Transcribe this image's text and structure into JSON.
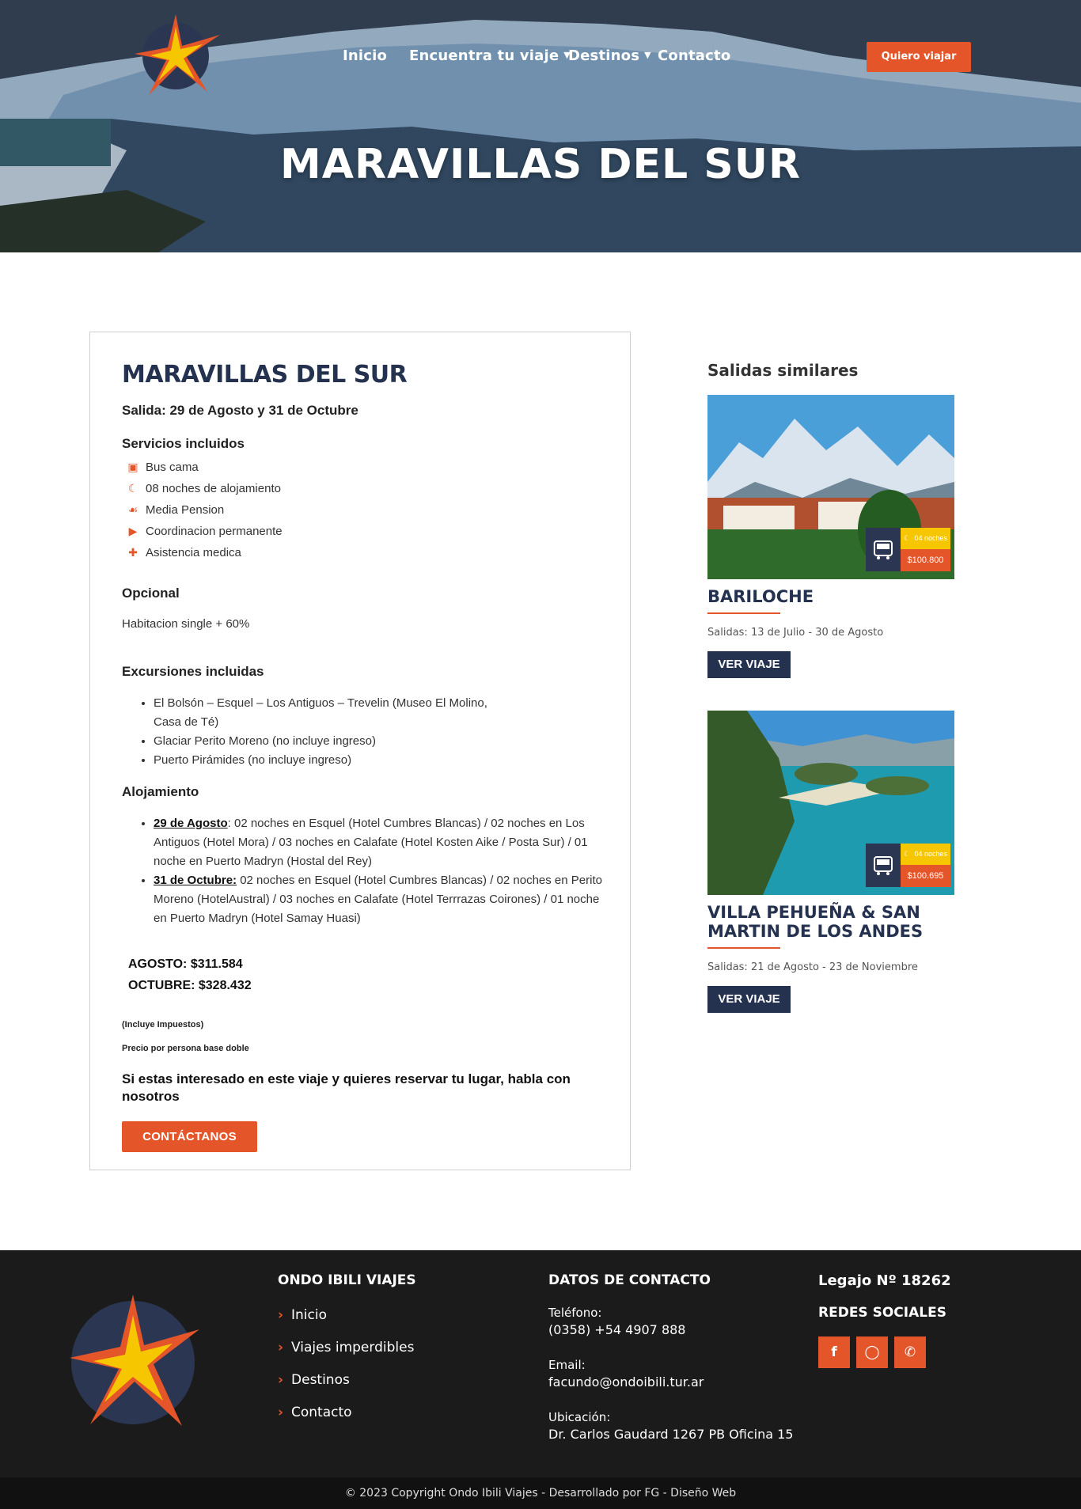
{
  "header": {
    "nav": [
      "Inicio",
      "Encuentra tu viaje",
      "Destinos",
      "Contacto"
    ],
    "cta": "Quiero viajar",
    "hero_title": "MARAVILLAS DEL SUR"
  },
  "trip": {
    "title": "MARAVILLAS DEL SUR",
    "salida": "Salida: 29 de Agosto y 31 de Octubre",
    "services_heading": "Servicios incluidos",
    "services": [
      {
        "icon": "bus-icon",
        "label": "Bus cama"
      },
      {
        "icon": "moon-icon",
        "label": "08 noches de alojamiento"
      },
      {
        "icon": "utensils-icon",
        "label": "Media Pension"
      },
      {
        "icon": "megaphone-icon",
        "label": "Coordinacion permanente"
      },
      {
        "icon": "medical-kit-icon",
        "label": "Asistencia medica"
      }
    ],
    "optional_heading": "Opcional",
    "optional": "Habitacion single  + 60%",
    "excursions_heading": "Excursiones incluidas",
    "excursions": [
      "El Bolsón – Esquel – Los Antiguos – Trevelin (Museo El Molino, Casa de Té)",
      "Glaciar Perito Moreno (no incluye ingreso)",
      "Puerto Pirámides (no incluye ingreso)"
    ],
    "lodging_heading": "Alojamiento",
    "lodging": [
      {
        "date": "29 de Agosto",
        "sep": ":",
        "text": " 02 noches en Esquel (Hotel Cumbres Blancas) / 02 noches en Los Antiguos (Hotel Mora) / 03 noches en Calafate (Hotel Kosten Aike / Posta Sur) / 01 noche en Puerto Madryn (Hostal del Rey)"
      },
      {
        "date": "31 de Octubre:",
        "sep": "",
        "text": " 02 noches en Esquel (Hotel Cumbres Blancas) / 02 noches en Perito Moreno (HotelAustral) / 03 noches en Calafate (Hotel Terrrazas Coirones) / 01 noche en Puerto Madryn (Hotel Samay Huasi)"
      }
    ],
    "price_1": "AGOSTO: $311.584",
    "price_2": "OCTUBRE: $328.432",
    "taxes_note": "(Incluye Impuestos)",
    "price_note": "Precio por persona base doble",
    "contact_question": "Si estas interesado en este viaje y quieres reservar tu lugar, habla con nosotros",
    "contact_button": "CONTÁCTANOS"
  },
  "sidebar": {
    "title": "Salidas similares",
    "trips": [
      {
        "name": "BARILOCHE",
        "dates": "Salidas: 13 de Julio - 30 de Agosto",
        "nights": "04 noches",
        "price": "$100.800",
        "button": "VER VIAJE"
      },
      {
        "name": "VILLA PEHUEÑA & SAN MARTIN DE LOS ANDES",
        "dates": "Salidas: 21 de Agosto - 23 de Noviembre",
        "nights": "04 noches",
        "price": "$100.695",
        "button": "VER VIAJE"
      }
    ]
  },
  "footer": {
    "col1_title": "ONDO IBILI VIAJES",
    "links": [
      "Inicio",
      "Viajes imperdibles",
      "Destinos",
      "Contacto"
    ],
    "col2_title": "DATOS DE CONTACTO",
    "phone_label": "Teléfono:",
    "phone": "(0358) +54 4907 888",
    "email_label": "Email:",
    "email": "facundo@ondoibili.tur.ar",
    "location_label": "Ubicación:",
    "location": "Dr. Carlos Gaudard 1267 PB Oficina 15",
    "legajo": "Legajo Nº 18262",
    "social_title": "REDES SOCIALES",
    "social": [
      "facebook-icon",
      "instagram-icon",
      "whatsapp-icon"
    ],
    "copyright": "© 2023 Copyright Ondo Ibili Viajes - Desarrollado por FG - Diseño Web"
  },
  "colors": {
    "accent": "#e5552a",
    "navy": "#24314f",
    "footer_bg": "#1b1b1b"
  }
}
